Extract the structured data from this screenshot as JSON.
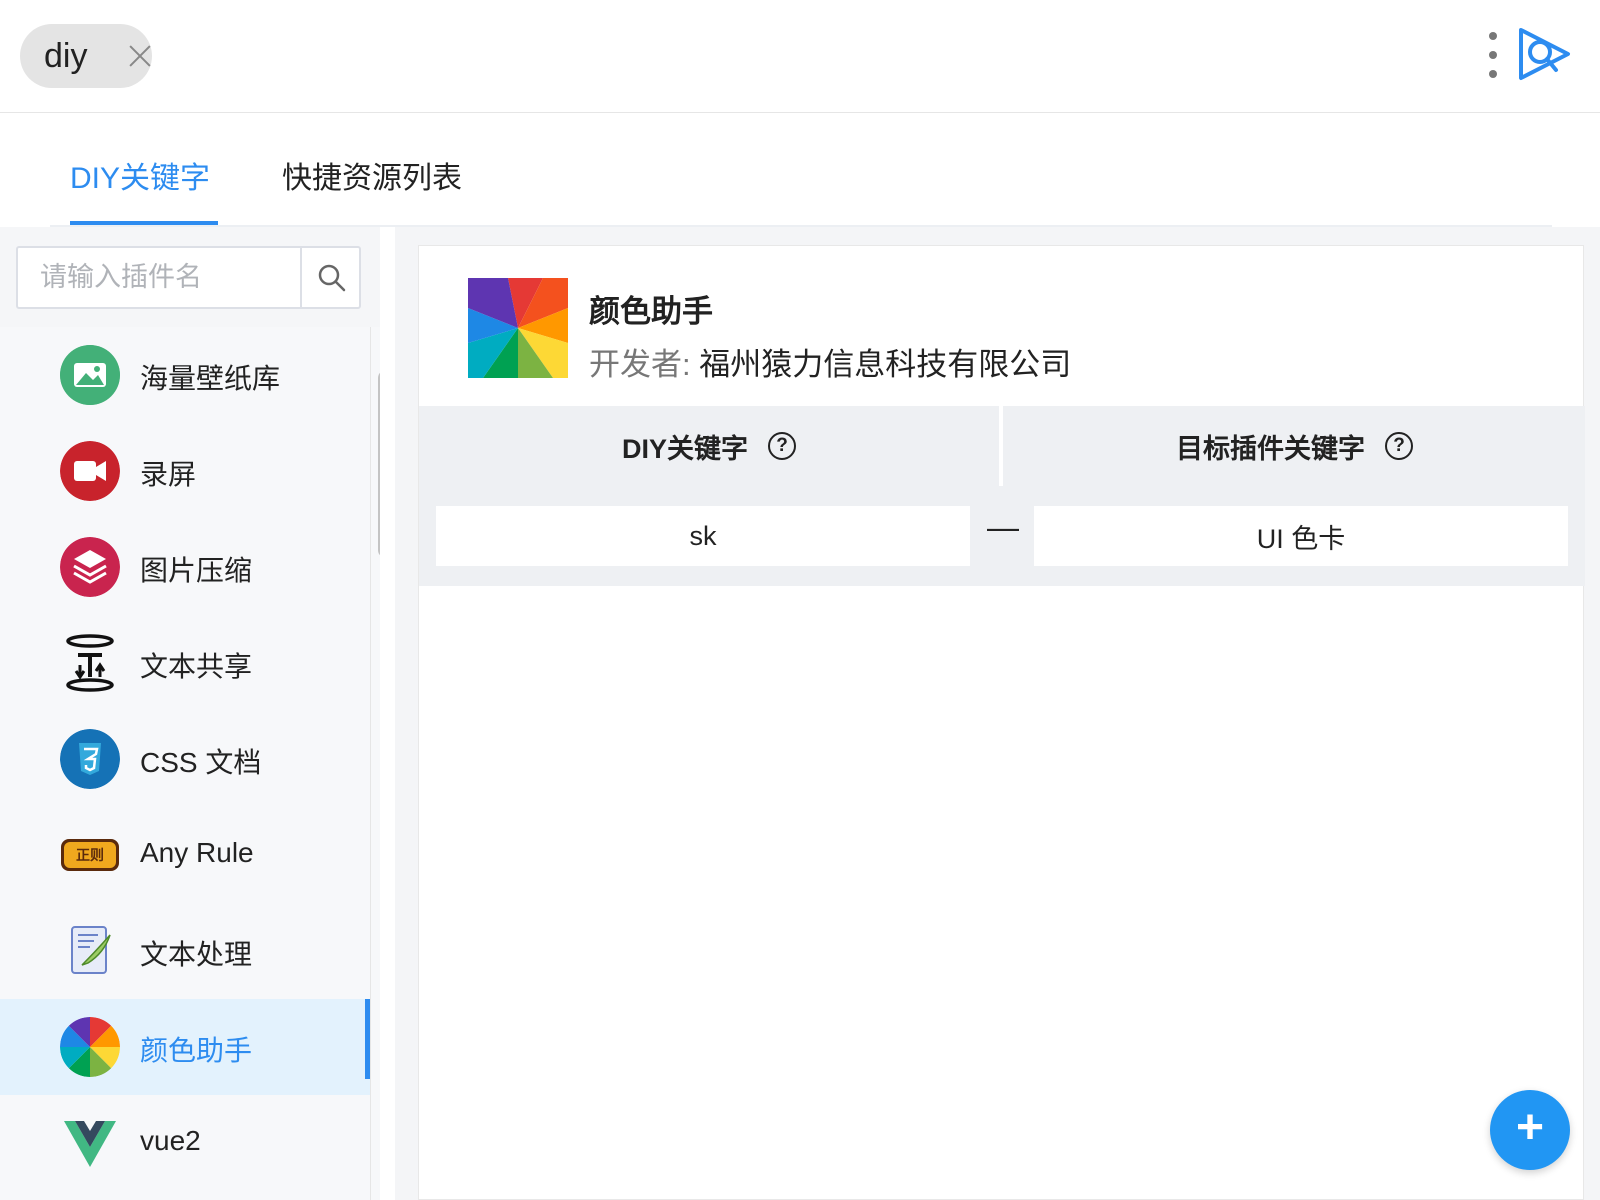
{
  "search": {
    "query": "diy"
  },
  "tabs": [
    {
      "label": "DIY关键字",
      "active": true
    },
    {
      "label": "快捷资源列表",
      "active": false
    }
  ],
  "sidebar": {
    "search_placeholder": "请输入插件名",
    "items": [
      {
        "label": "海量壁纸库",
        "icon": "mountain-photo-icon",
        "selected": false
      },
      {
        "label": "录屏",
        "icon": "video-camera-icon",
        "selected": false
      },
      {
        "label": "图片压缩",
        "icon": "layers-icon",
        "selected": false
      },
      {
        "label": "文本共享",
        "icon": "text-transfer-icon",
        "selected": false
      },
      {
        "label": "CSS 文档",
        "icon": "css3-icon",
        "selected": false
      },
      {
        "label": "Any Rule",
        "icon": "regex-logo-icon",
        "selected": false
      },
      {
        "label": "文本处理",
        "icon": "notepad-quill-icon",
        "selected": false
      },
      {
        "label": "颜色助手",
        "icon": "color-wheel-icon",
        "selected": true
      },
      {
        "label": "vue2",
        "icon": "vue-logo-icon",
        "selected": false
      }
    ]
  },
  "plugin": {
    "name": "颜色助手",
    "developer_label": "开发者:",
    "developer_name": "福州猿力信息科技有限公司"
  },
  "table": {
    "col_diy": "DIY关键字",
    "col_target": "目标插件关键字",
    "help_glyph": "?",
    "rows": [
      {
        "diy": "sk",
        "separator": "—",
        "target": "UI 色卡"
      }
    ]
  },
  "fab": {
    "label": "+"
  },
  "colors": {
    "accent": "#2d8cf0",
    "selected_bg": "#e3f2fd",
    "fab": "#2196f3"
  }
}
